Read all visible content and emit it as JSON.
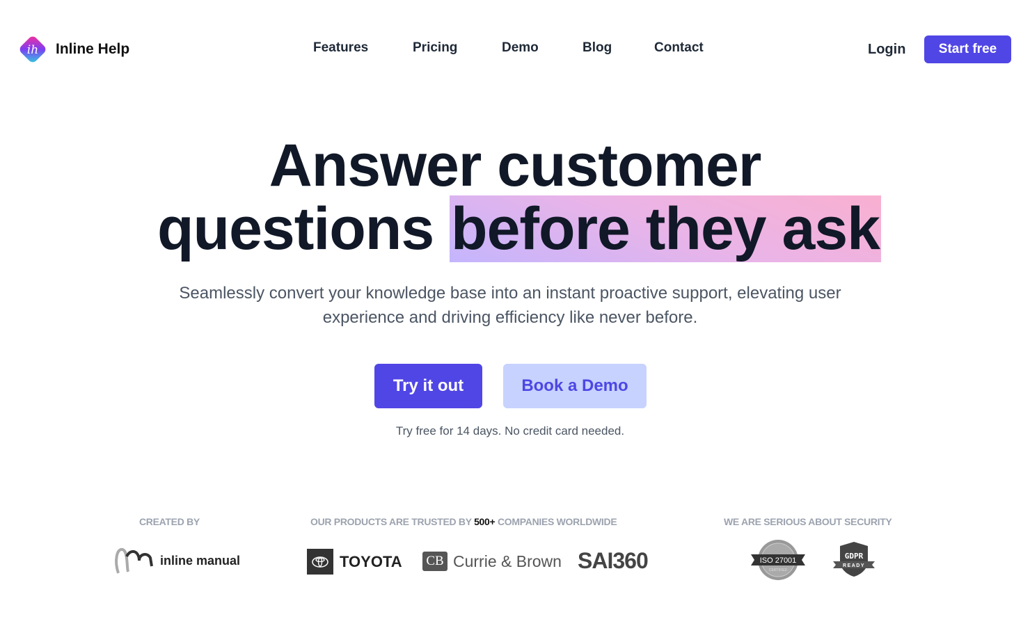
{
  "header": {
    "logo_text": "Inline Help",
    "logo_mark": "ih",
    "nav": [
      "Features",
      "Pricing",
      "Demo",
      "Blog",
      "Contact"
    ],
    "login": "Login",
    "start_free": "Start free",
    "accent": "#5046e5"
  },
  "hero": {
    "line1": "Answer customer",
    "line2_plain": "questions ",
    "line2_highlight": "before they ask",
    "subtitle_1": "Seamlessly convert your knowledge base into an instant proactive support, elevating user",
    "subtitle_2": "experience and driving efficiency like never before.",
    "try_button": "Try it out",
    "demo_button": "Book a Demo",
    "note": "Try free for 14 days. No credit card needed."
  },
  "footer": {
    "created_by": "CREATED BY",
    "creator": "inline manual",
    "trusted_pre": "OUR PRODUCTS ARE TRUSTED BY ",
    "trusted_count": "500+",
    "trusted_post": " COMPANIES WORLDWIDE",
    "brands": [
      "TOYOTA",
      "Currie & Brown",
      "SAI360"
    ],
    "cb_mark": "CB",
    "security": "WE ARE SERIOUS ABOUT SECURITY",
    "iso": "ISO 27001",
    "iso_sub": "CERTIFIED",
    "gdpr": "GDPR",
    "gdpr_sub": "READY"
  }
}
